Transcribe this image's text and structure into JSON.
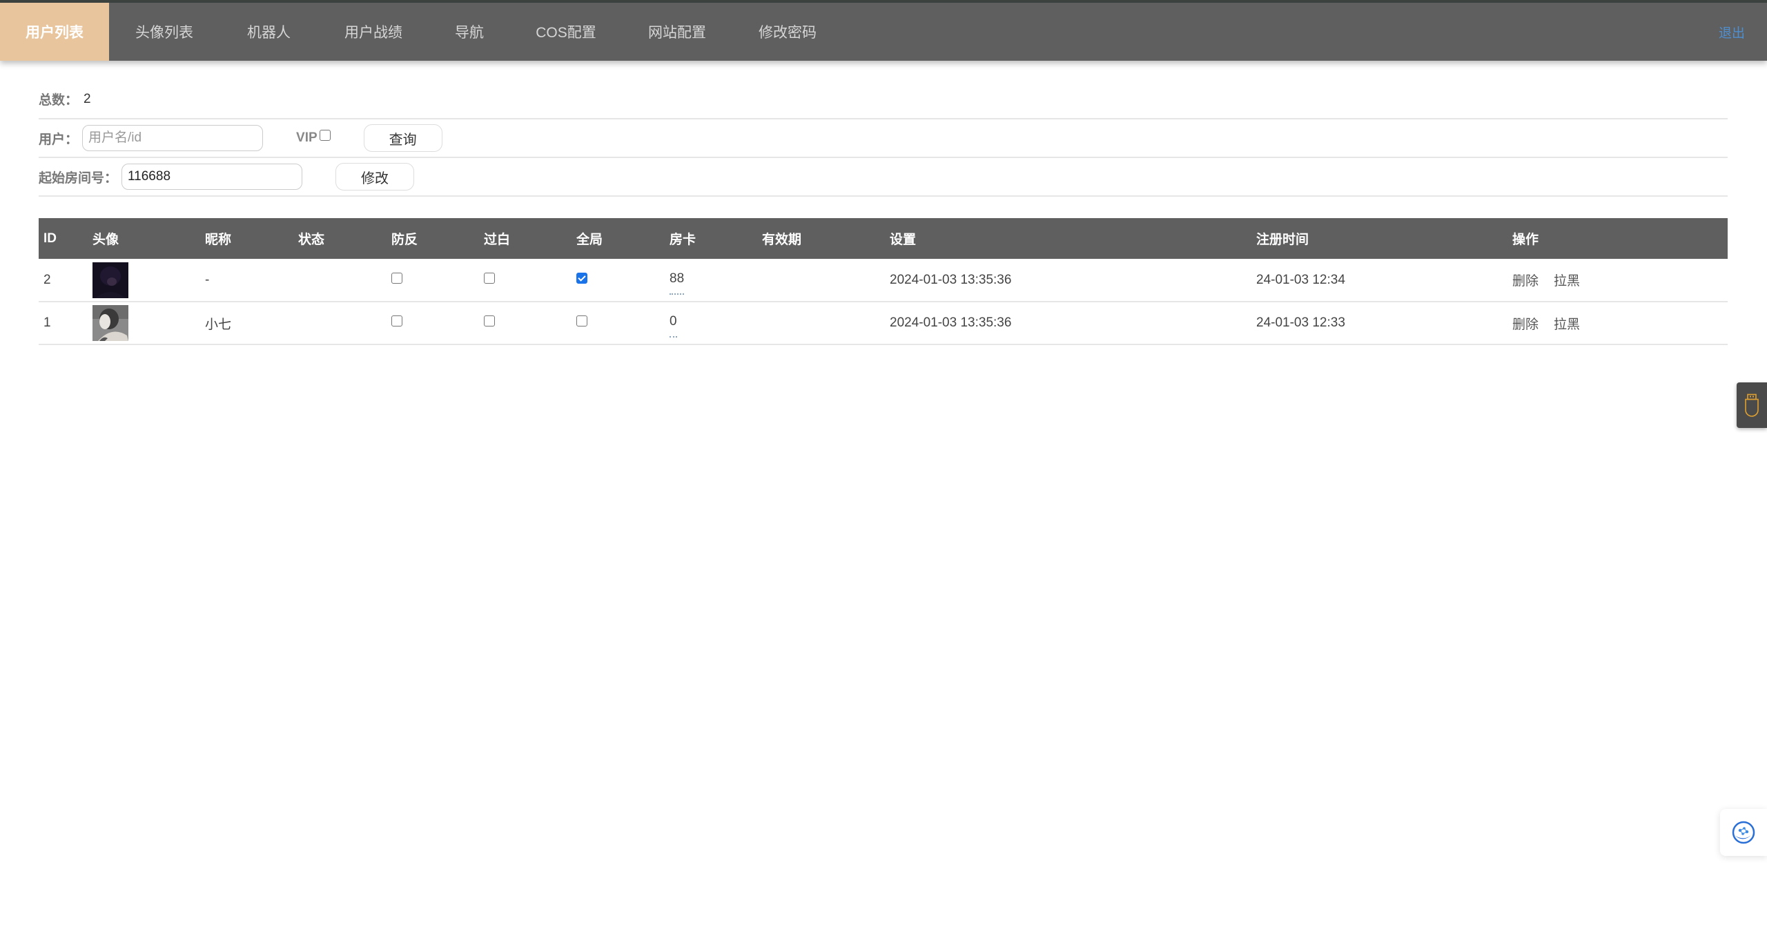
{
  "nav": {
    "items": [
      {
        "label": "用户列表",
        "active": true
      },
      {
        "label": "头像列表",
        "active": false
      },
      {
        "label": "机器人",
        "active": false
      },
      {
        "label": "用户战绩",
        "active": false
      },
      {
        "label": "导航",
        "active": false
      },
      {
        "label": "COS配置",
        "active": false
      },
      {
        "label": "网站配置",
        "active": false
      },
      {
        "label": "修改密码",
        "active": false
      }
    ],
    "logout_label": "退出"
  },
  "summary": {
    "total_label": "总数：",
    "total_value": "2"
  },
  "search": {
    "user_label": "用户：",
    "user_placeholder": "用户名/id",
    "user_value": "",
    "vip_label": "VIP",
    "vip_checked": false,
    "query_button": "查询"
  },
  "room": {
    "label": "起始房间号：",
    "value": "116688",
    "modify_button": "修改"
  },
  "table": {
    "columns": [
      "ID",
      "头像",
      "昵称",
      "状态",
      "防反",
      "过白",
      "全局",
      "房卡",
      "有效期",
      "设置",
      "注册时间",
      "操作"
    ],
    "rows": [
      {
        "id": "2",
        "avatar": "dark-hooded-figure",
        "nickname": "-",
        "status": "",
        "fangfan": false,
        "guobai": false,
        "quanju": true,
        "room_card": "88",
        "validity": "",
        "settings": "2024-01-03 13:35:36",
        "register_time": "24-01-03 12:34",
        "actions": [
          "删除",
          "拉黑"
        ]
      },
      {
        "id": "1",
        "avatar": "anime-girl-profile",
        "nickname": "小七",
        "status": "",
        "fangfan": false,
        "guobai": false,
        "quanju": false,
        "room_card": "0",
        "validity": "",
        "settings": "2024-01-03 13:35:36",
        "register_time": "24-01-03 12:33",
        "actions": [
          "删除",
          "拉黑"
        ]
      }
    ]
  },
  "colors": {
    "nav_bg": "#5f5f5f",
    "nav_active": "#e8c59d",
    "logout": "#4f8fd0",
    "checkbox_checked": "#1a73e8",
    "usb_icon": "#e0a030"
  },
  "floating": {
    "usb_icon": "usb-drive-icon",
    "assistant_icon": "assistant-icon"
  }
}
